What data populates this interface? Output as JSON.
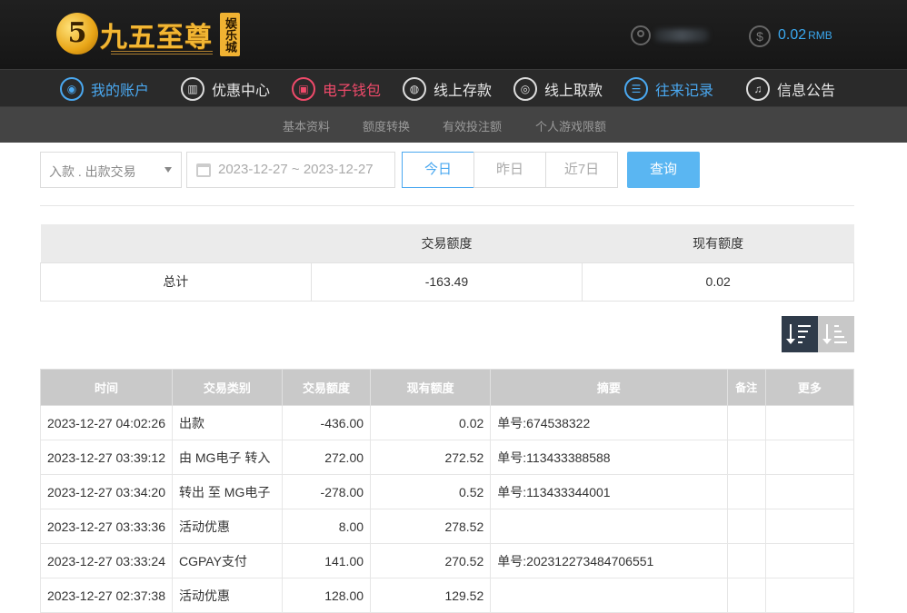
{
  "brand": {
    "logo_mark": "5",
    "name": "九五至尊",
    "badge": "娱乐城"
  },
  "account": {
    "balance": "0.02",
    "currency": "RMB"
  },
  "nav": {
    "items": [
      {
        "label": "我的账户",
        "icon": "user-icon",
        "icon_glyph": "◉"
      },
      {
        "label": "优惠中心",
        "icon": "gift-icon",
        "icon_glyph": "▥"
      },
      {
        "label": "电子钱包",
        "icon": "wallet-icon",
        "icon_glyph": "▣"
      },
      {
        "label": "线上存款",
        "icon": "deposit-icon",
        "icon_glyph": "◍"
      },
      {
        "label": "线上取款",
        "icon": "withdraw-icon",
        "icon_glyph": "◎"
      },
      {
        "label": "往来记录",
        "icon": "records-icon",
        "icon_glyph": "☰"
      },
      {
        "label": "信息公告",
        "icon": "bell-icon",
        "icon_glyph": "♫"
      }
    ]
  },
  "subnav": {
    "items": [
      "基本资料",
      "额度转换",
      "有效投注额",
      "个人游戏限额"
    ]
  },
  "filters": {
    "type_select": "入款 . 出款交易",
    "date_range": "2023-12-27 ~ 2023-12-27",
    "quick": [
      "今日",
      "昨日",
      "近7日"
    ],
    "query_label": "查询"
  },
  "summary": {
    "headers": [
      "",
      "交易额度",
      "现有额度"
    ],
    "row": [
      "总计",
      "-163.49",
      "0.02"
    ]
  },
  "records": {
    "headers": [
      "时间",
      "交易类别",
      "交易额度",
      "现有额度",
      "摘要",
      "备注",
      "更多"
    ],
    "rows": [
      [
        "2023-12-27 04:02:26",
        "出款",
        "-436.00",
        "0.02",
        "单号:674538322",
        "",
        ""
      ],
      [
        "2023-12-27 03:39:12",
        "由 MG电子 转入",
        "272.00",
        "272.52",
        "单号:113433388588",
        "",
        ""
      ],
      [
        "2023-12-27 03:34:20",
        "转出 至 MG电子",
        "-278.00",
        "0.52",
        "单号:113433344001",
        "",
        ""
      ],
      [
        "2023-12-27 03:33:36",
        "活动优惠",
        "8.00",
        "278.52",
        "",
        "",
        ""
      ],
      [
        "2023-12-27 03:33:24",
        "CGPAY支付",
        "141.00",
        "270.52",
        "单号:202312273484706551",
        "",
        ""
      ],
      [
        "2023-12-27 02:37:38",
        "活动优惠",
        "128.00",
        "129.52",
        "",
        "",
        ""
      ]
    ]
  },
  "colors": {
    "accent_blue": "#4aa8f0",
    "accent_red": "#ef4a6a",
    "brand_gold": "#f2b633"
  }
}
